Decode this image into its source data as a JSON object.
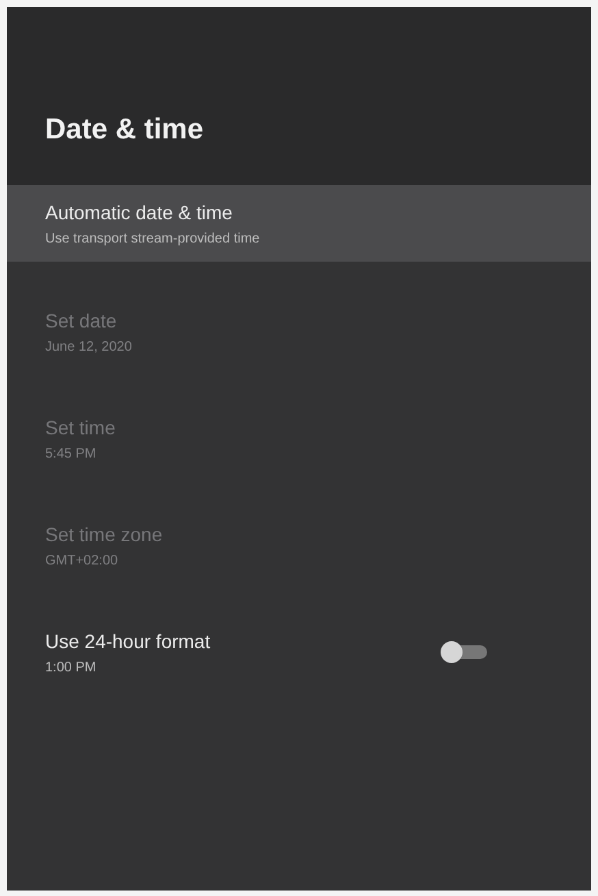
{
  "title": "Date & time",
  "items": [
    {
      "kind": "plain",
      "label": "Automatic date & time",
      "value": "Use transport stream-provided time",
      "selected": true,
      "disabled": false
    },
    {
      "kind": "plain",
      "label": "Set date",
      "value": "June 12, 2020",
      "selected": false,
      "disabled": true
    },
    {
      "kind": "plain",
      "label": "Set time",
      "value": "5:45 PM",
      "selected": false,
      "disabled": true
    },
    {
      "kind": "plain",
      "label": "Set time zone",
      "value": "GMT+02:00",
      "selected": false,
      "disabled": true
    },
    {
      "kind": "toggle",
      "label": "Use 24-hour format",
      "value": "1:00 PM",
      "selected": false,
      "disabled": false,
      "on": false
    }
  ]
}
